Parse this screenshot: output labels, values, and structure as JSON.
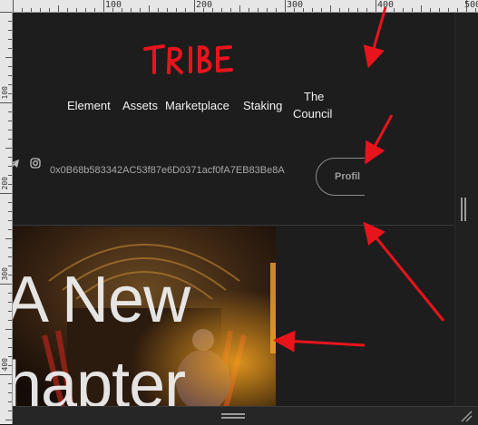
{
  "ruler": {
    "labels": [
      "100",
      "200",
      "300",
      "400",
      "500"
    ],
    "vertical_labels": [
      "100",
      "200",
      "300",
      "400"
    ]
  },
  "logo_text": "TRIBE",
  "nav": {
    "items": [
      "Element",
      "Assets",
      "Marketplace",
      "Staking",
      "The",
      "Council"
    ]
  },
  "social": {
    "icons": [
      "telegram-icon",
      "instagram-icon"
    ]
  },
  "wallet": {
    "address": "0x0B68b583342AC53f87e6D0371acf0fA7EB83Be8A"
  },
  "profile_button": "Profil",
  "hero": {
    "line1": "A New",
    "line2": "hapter"
  },
  "colors": {
    "background": "#1d1d1d",
    "logo": "#e8141c",
    "arrows": "#e8141c",
    "text": "#f2f2f2"
  }
}
